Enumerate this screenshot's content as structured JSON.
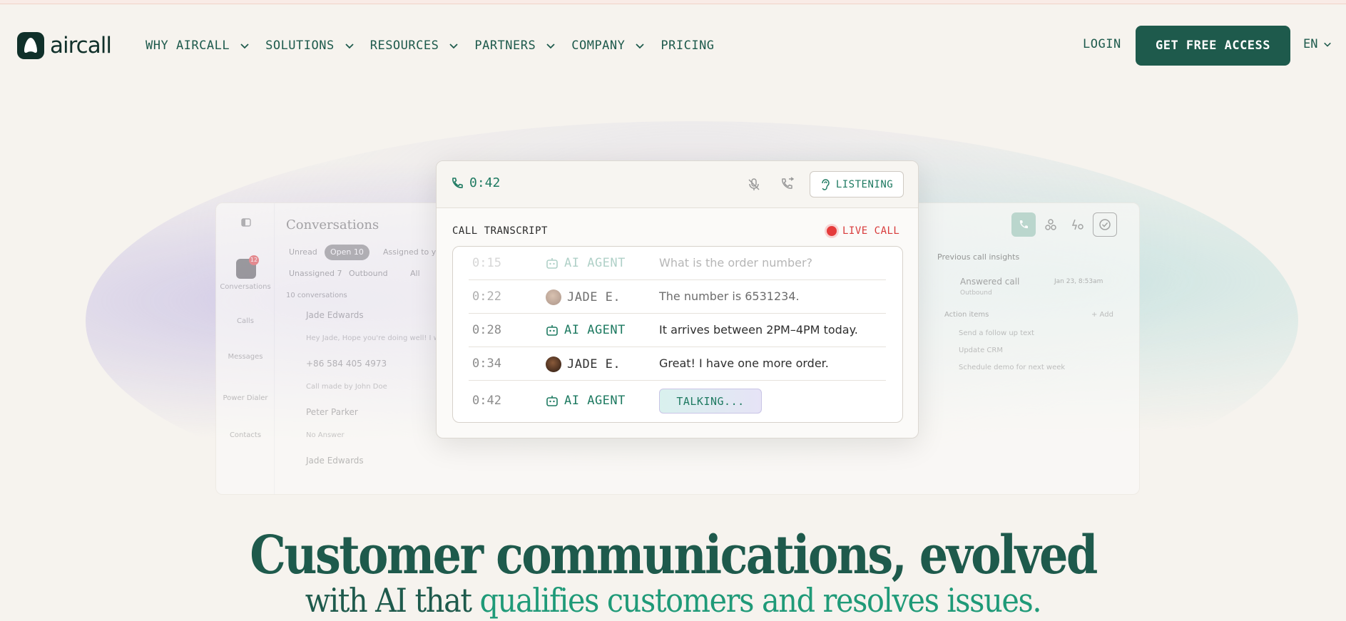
{
  "brand": {
    "name": "aircall"
  },
  "nav": {
    "items": [
      {
        "label": "WHY AIRCALL",
        "dropdown": true
      },
      {
        "label": "SOLUTIONS",
        "dropdown": true
      },
      {
        "label": "RESOURCES",
        "dropdown": true
      },
      {
        "label": "PARTNERS",
        "dropdown": true
      },
      {
        "label": "COMPANY",
        "dropdown": true
      },
      {
        "label": "PRICING",
        "dropdown": false
      }
    ],
    "login": "LOGIN",
    "cta": "GET FREE ACCESS",
    "language": "EN"
  },
  "background_app": {
    "title": "Conversations",
    "sidebar": [
      "Conversations",
      "Calls",
      "Messages",
      "Power Dialer",
      "Contacts"
    ],
    "sidebar_badge": "12",
    "filters": [
      "Unread",
      "Open 10",
      "Assigned to you"
    ],
    "filters2": [
      "Unassigned 7",
      "Outbound",
      "All"
    ],
    "count": "10 conversations",
    "rows": [
      {
        "name": "Jade Edwards",
        "sub": "Hey Jade, Hope you're doing well! I w"
      },
      {
        "name": "+86 584 405 4973",
        "sub": "Call made by John Doe"
      },
      {
        "name": "Peter Parker",
        "sub": "No Answer"
      },
      {
        "name": "Jade Edwards",
        "sub": ""
      }
    ],
    "insights": {
      "title": "Previous call insights",
      "call": "Answered call",
      "call_sub": "Outbound",
      "call_date": "Jan 23, 8:53am",
      "action_title": "Action items",
      "add": "+ Add",
      "actions": [
        "Send a follow up text",
        "Update CRM",
        "Schedule demo for next week"
      ]
    }
  },
  "call": {
    "timer": "0:42",
    "listening": "LISTENING",
    "transcript_label": "CALL TRANSCRIPT",
    "live_label": "LIVE CALL",
    "rows": [
      {
        "time": "0:15",
        "speaker": "AI AGENT",
        "type": "ai",
        "text": "What is the order number?"
      },
      {
        "time": "0:22",
        "speaker": "JADE E.",
        "type": "jade",
        "text": "The number is 6531234."
      },
      {
        "time": "0:28",
        "speaker": "AI AGENT",
        "type": "ai",
        "text": "It arrives between 2PM–4PM today."
      },
      {
        "time": "0:34",
        "speaker": "JADE E.",
        "type": "jade",
        "text": "Great! I have one more order."
      },
      {
        "time": "0:42",
        "speaker": "AI AGENT",
        "type": "ai",
        "text": "TALKING..."
      }
    ]
  },
  "hero": {
    "headline": "Customer communications, evolved",
    "sub_prefix": "with AI that ",
    "sub_accent": "qualifies customers and resolves issues."
  },
  "colors": {
    "brand_dark": "#1e5a4c",
    "accent_green": "#1f9a78",
    "live_red": "#e53b3b",
    "background": "#f6f3ee"
  }
}
